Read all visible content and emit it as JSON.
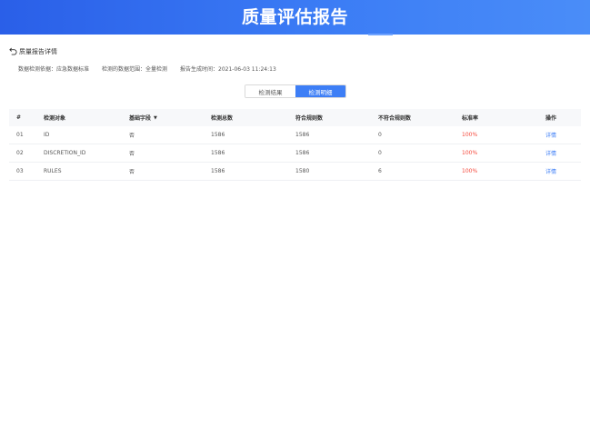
{
  "header": {
    "title": "质量评估报告"
  },
  "nav": {
    "back_label": "质量报告详情"
  },
  "meta": {
    "standard": "数据检测依据：应急数据标准",
    "scope": "检测的数据范围：全量检测",
    "generated_at": "报告生成时间：2021-06-03 11:24:13"
  },
  "tabs": [
    {
      "label": "检测结果",
      "active": false
    },
    {
      "label": "检测明细",
      "active": true
    }
  ],
  "table": {
    "columns": [
      "#",
      "检测对象",
      "基础字段",
      "检测总数",
      "符合规则数",
      "不符合规则数",
      "标准率",
      "操作"
    ],
    "rows": [
      {
        "index": "01",
        "object": "ID",
        "base_field": "否",
        "total": "1586",
        "pass": "1586",
        "fail": "0",
        "rate": "100%",
        "action": "详情"
      },
      {
        "index": "02",
        "object": "DISCRETION_ID",
        "base_field": "否",
        "total": "1586",
        "pass": "1586",
        "fail": "0",
        "rate": "100%",
        "action": "详情"
      },
      {
        "index": "03",
        "object": "RULES",
        "base_field": "否",
        "total": "1586",
        "pass": "1580",
        "fail": "6",
        "rate": "100%",
        "action": "详情"
      }
    ]
  },
  "colors": {
    "banner": "#3b7cf5",
    "accent": "#3d7ef6",
    "rate": "#f5483b"
  },
  "icons": {
    "back": "undo-arrow-icon",
    "sort": "caret-down-icon"
  }
}
